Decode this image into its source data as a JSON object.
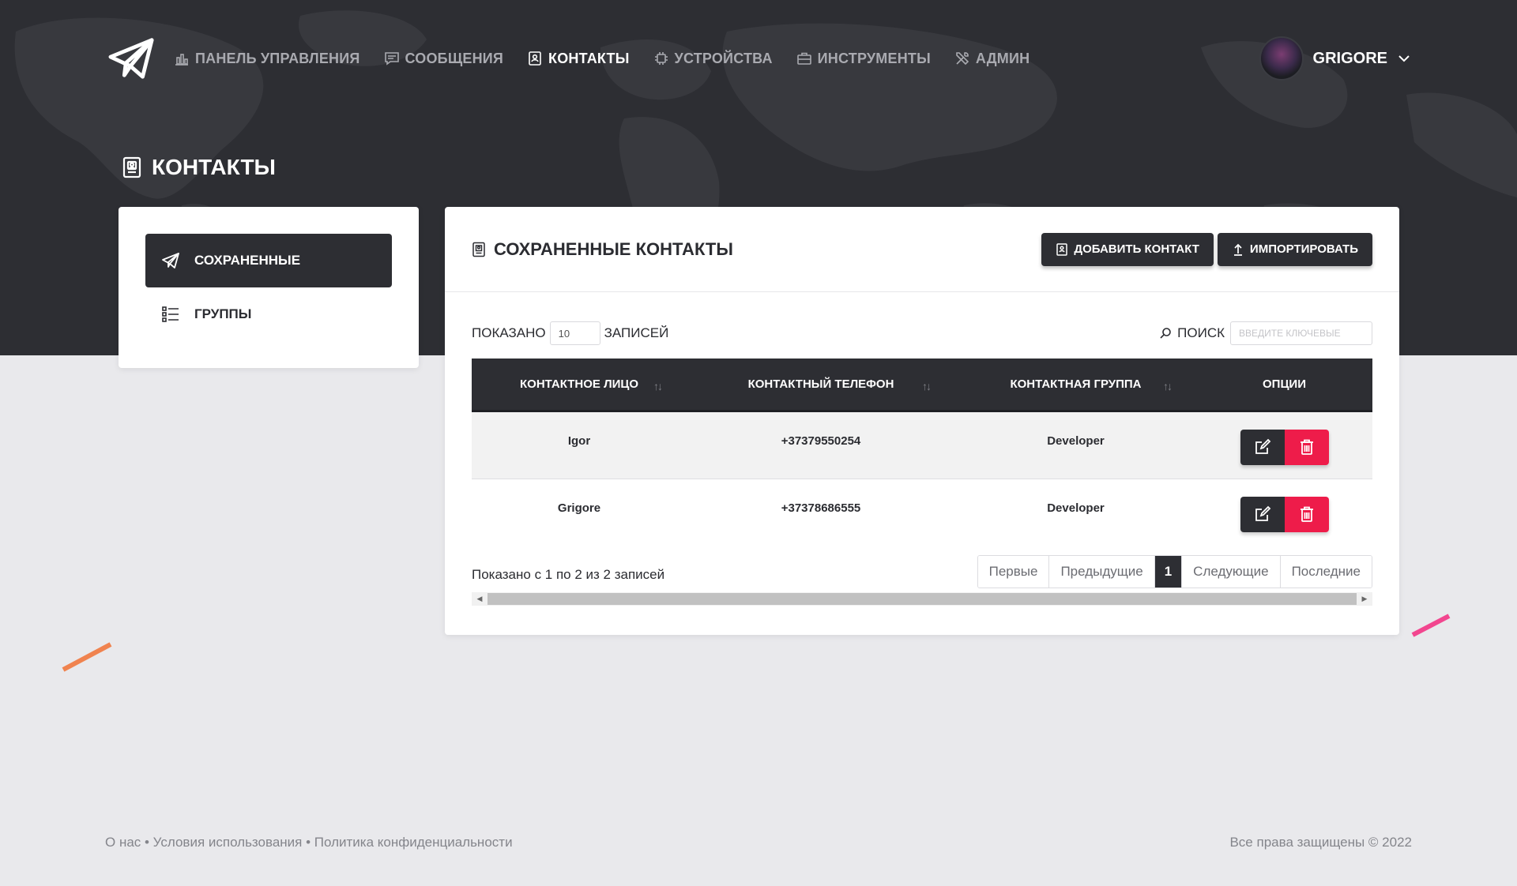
{
  "nav": {
    "items": [
      {
        "label": "Панель управления",
        "icon": "bar-chart-icon",
        "active": false
      },
      {
        "label": "Сообщения",
        "icon": "message-icon",
        "active": false
      },
      {
        "label": "Контакты",
        "icon": "contact-book-icon",
        "active": true
      },
      {
        "label": "Устройства",
        "icon": "chip-icon",
        "active": false
      },
      {
        "label": "Инструменты",
        "icon": "briefcase-icon",
        "active": false
      },
      {
        "label": "Админ",
        "icon": "tools-icon",
        "active": false
      }
    ],
    "user": {
      "name": "GRIGORE"
    }
  },
  "page": {
    "title": "Контакты"
  },
  "sidebar": {
    "items": [
      {
        "label": "Сохраненные",
        "icon": "paper-plane-icon",
        "active": true
      },
      {
        "label": "Группы",
        "icon": "list-icon",
        "active": false
      }
    ]
  },
  "card": {
    "title": "Сохраненные контакты",
    "add_label": "Добавить контакт",
    "import_label": "Импортировать"
  },
  "controls": {
    "show_prefix": "Показано",
    "show_value": "10",
    "show_suffix": "записей",
    "search_label": "Поиск",
    "search_placeholder": "Введите ключевые"
  },
  "table": {
    "columns": [
      "Контактное лицо",
      "Контактный телефон",
      "Контактная группа",
      "Опции"
    ],
    "rows": [
      {
        "name": "Igor",
        "phone": "+37379550254",
        "group": "Developer"
      },
      {
        "name": "Grigore",
        "phone": "+37378686555",
        "group": "Developer"
      }
    ]
  },
  "info": "Показано с 1 по 2 из 2 записей",
  "pagination": {
    "first": "Первые",
    "previous": "Предыдущие",
    "current": "1",
    "next": "Следующие",
    "last": "Последние"
  },
  "footer": {
    "links": "О нас • Условия использования • Политика конфиденциальности",
    "copyright": "Все права защищены © 2022"
  },
  "colors": {
    "dark": "#2d2e33",
    "danger": "#ee1c4a",
    "background": "#e9e9ec",
    "accent_orange": "#f0834f",
    "accent_pink": "#f2468f"
  }
}
